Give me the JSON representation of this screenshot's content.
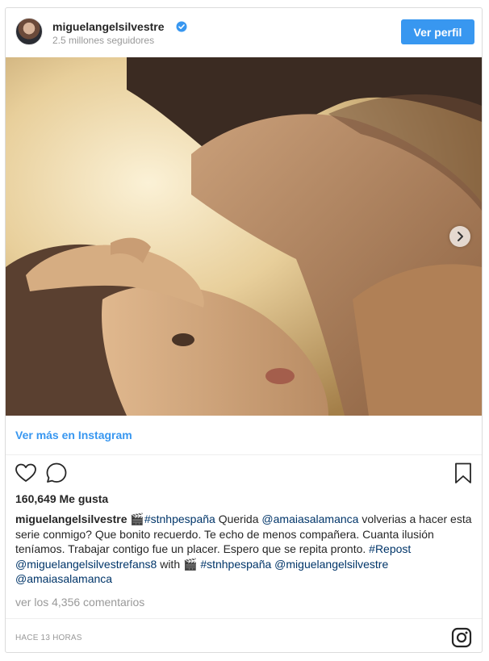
{
  "post": {
    "username": "miguelangelsilvestre",
    "followers": "2.5 millones seguidores",
    "view_profile": "Ver perfil",
    "view_more": "Ver más en Instagram",
    "likes": "160,649 Me gusta",
    "caption": {
      "username": "miguelangelsilvestre",
      "parts": [
        {
          "t": " 🎬",
          "k": "text"
        },
        {
          "t": "#stnhpespaña",
          "k": "tag"
        },
        {
          "t": " Querida ",
          "k": "text"
        },
        {
          "t": "@amaiasalamanca",
          "k": "tag"
        },
        {
          "t": " volverias a hacer esta serie conmigo? Que bonito recuerdo. Te echo de menos compañera. Cuanta ilusión teníamos. Trabajar contigo fue un placer. Espero que se repita pronto. ",
          "k": "text"
        },
        {
          "t": "#Repost",
          "k": "tag"
        },
        {
          "t": " ",
          "k": "text"
        },
        {
          "t": "@miguelangelsilvestrefans8",
          "k": "tag"
        },
        {
          "t": " with 🎬 ",
          "k": "text"
        },
        {
          "t": "#stnhpespaña",
          "k": "tag"
        },
        {
          "t": " ",
          "k": "text"
        },
        {
          "t": "@miguelangelsilvestre",
          "k": "tag"
        },
        {
          "t": " ",
          "k": "text"
        },
        {
          "t": "@amaiasalamanca",
          "k": "tag"
        }
      ]
    },
    "comments": "ver los 4,356 comentarios",
    "time": "HACE 13 HORAS"
  },
  "colors": {
    "accent": "#3897f0",
    "tag": "#003569",
    "muted": "#999999",
    "verified": "#3897f0"
  },
  "icons": [
    "verified-badge-icon",
    "chevron-right-icon",
    "heart-icon",
    "comment-icon",
    "bookmark-icon",
    "instagram-logo-icon"
  ]
}
